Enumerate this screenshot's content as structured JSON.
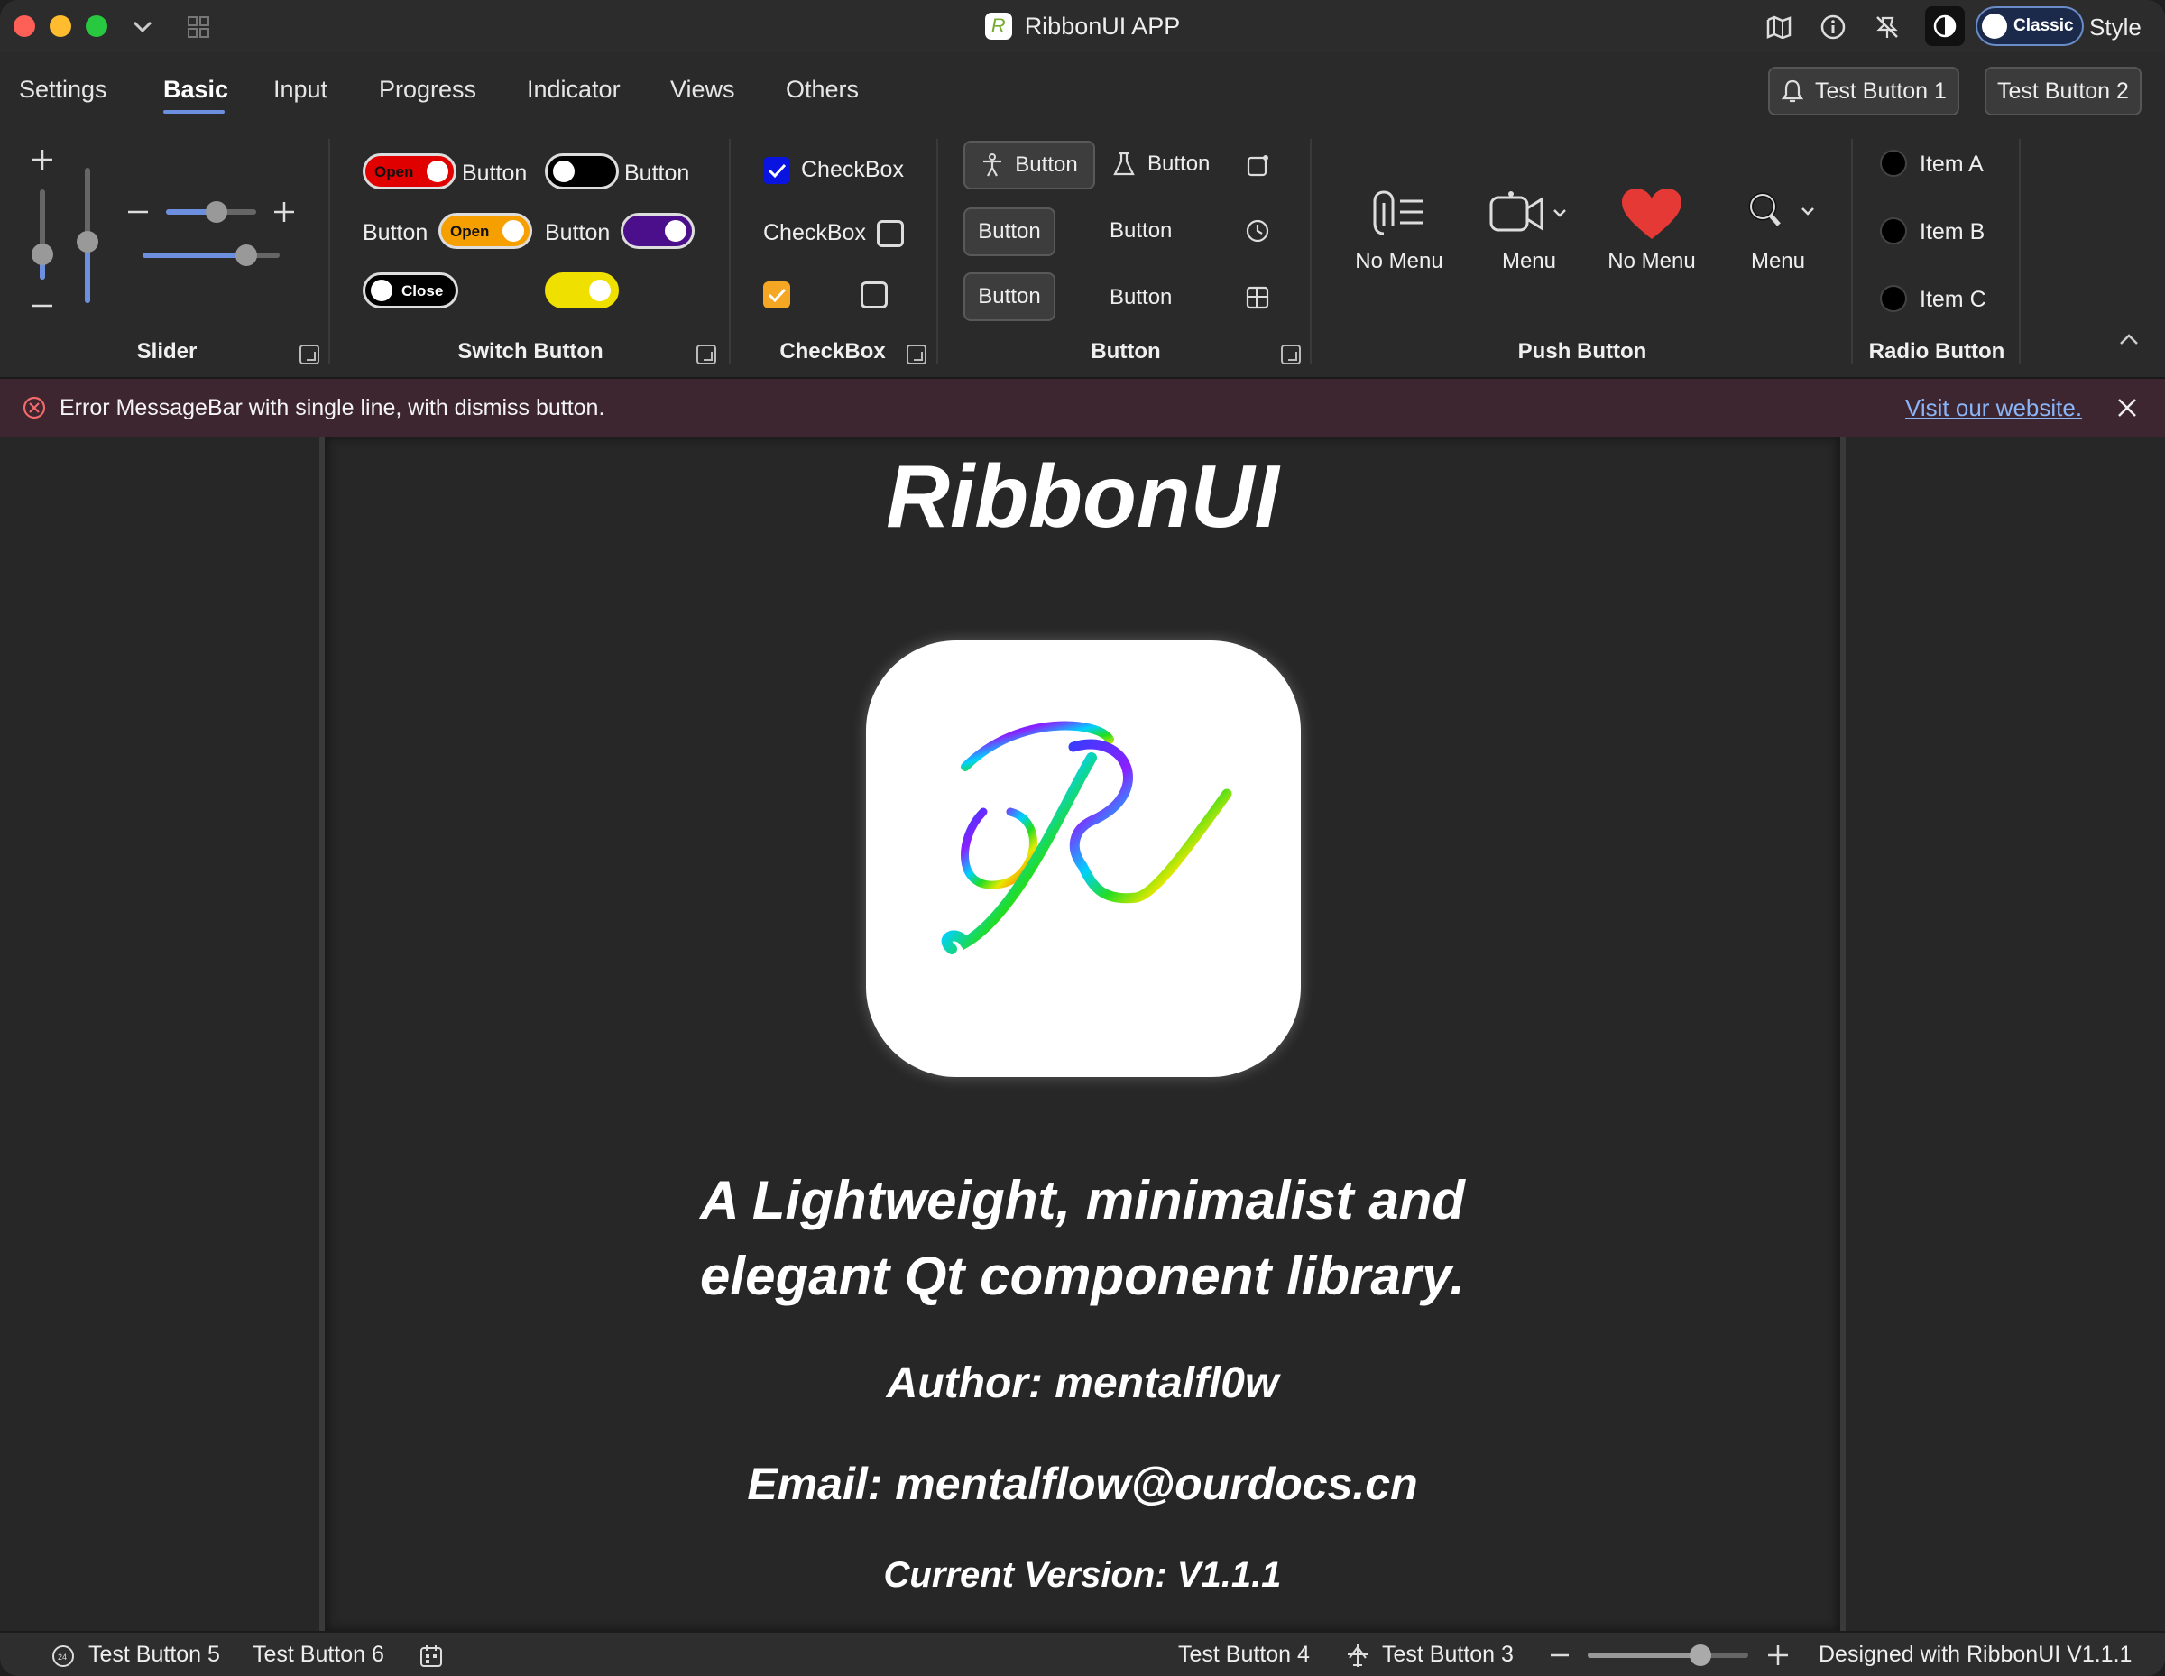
{
  "window": {
    "title": "RibbonUI APP",
    "title_icon": "ribbon-logo-icon",
    "style_toggle_label": "Classic",
    "style_label": "Style",
    "titlebar_icons": [
      "map-icon",
      "info-icon",
      "pin-off-icon",
      "theme-contrast-icon"
    ]
  },
  "tabs": [
    "Settings",
    "Basic",
    "Input",
    "Progress",
    "Indicator",
    "Views",
    "Others"
  ],
  "active_tab": "Basic",
  "top_buttons": {
    "test1": "Test Button 1",
    "test2": "Test Button 2"
  },
  "ribbon": {
    "slider": {
      "title": "Slider"
    },
    "switch": {
      "title": "Switch Button",
      "label": "Button",
      "open_text": "Open",
      "close_text": "Close"
    },
    "checkbox": {
      "title": "CheckBox",
      "label": "CheckBox"
    },
    "button": {
      "title": "Button",
      "label": "Button"
    },
    "push": {
      "title": "Push Button",
      "items": [
        "No Menu",
        "Menu",
        "No Menu",
        "Menu"
      ]
    },
    "radio": {
      "title": "Radio Button",
      "items": [
        "Item A",
        "Item B",
        "Item C"
      ]
    }
  },
  "message_bar": {
    "text": "Error MessageBar with single line, with dismiss button.",
    "link": "Visit our website."
  },
  "content": {
    "title": "RibbonUI",
    "logo_letter": "R",
    "tagline_1": "A Lightweight, minimalist and",
    "tagline_2": "elegant Qt component library.",
    "author": "Author: mentalfl0w",
    "email": "Email: mentalflow@ourdocs.cn",
    "version": "Current Version: V1.1.1"
  },
  "status_bar": {
    "b5": "Test Button 5",
    "b6": "Test Button 6",
    "b4": "Test Button 4",
    "b3": "Test Button 3",
    "designed": "Designed with RibbonUI V1.1.1",
    "zoom_fraction": 0.7
  },
  "colors": {
    "accent": "#6c8fe0",
    "error_bar": "#3d2630",
    "switch_red": "#e00000",
    "switch_orange": "#f5a000",
    "switch_purple": "#4b0f8c",
    "switch_yellow": "#f0e000",
    "checkbox_blue": "#0a14e0",
    "checkbox_orange": "#f5a623",
    "heart": "#e53935"
  }
}
